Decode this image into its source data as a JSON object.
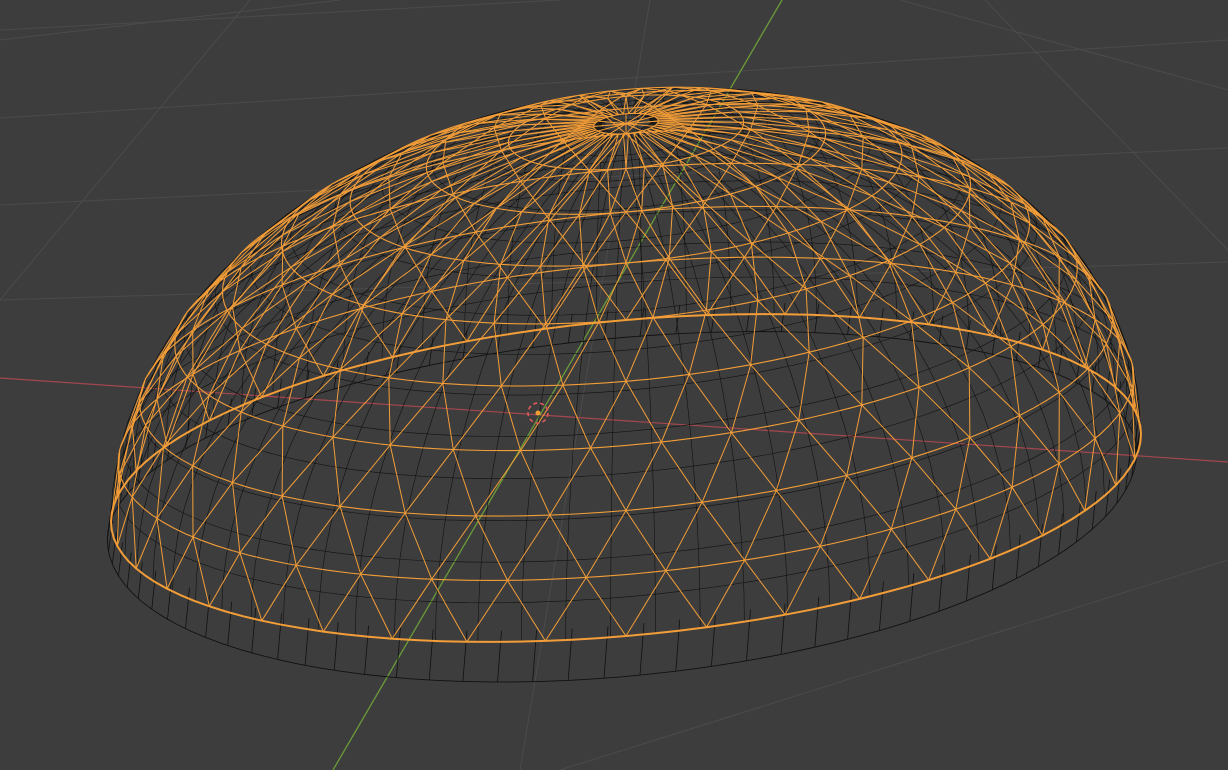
{
  "viewport": {
    "mode": "wireframe",
    "background_color": "#3d3d3d",
    "grid_color": "#4b4b4b",
    "x_axis_color": "#a5474f",
    "y_axis_color": "#6a9b3a"
  },
  "object": {
    "type": "dome",
    "selected": true,
    "selected_wire_color": "#f29d38",
    "inner_wire_color": "#111111"
  },
  "origin": {
    "icon": "3d-cursor-icon",
    "ring_color": "#e05a5a",
    "dot_color": "#f29d38"
  }
}
